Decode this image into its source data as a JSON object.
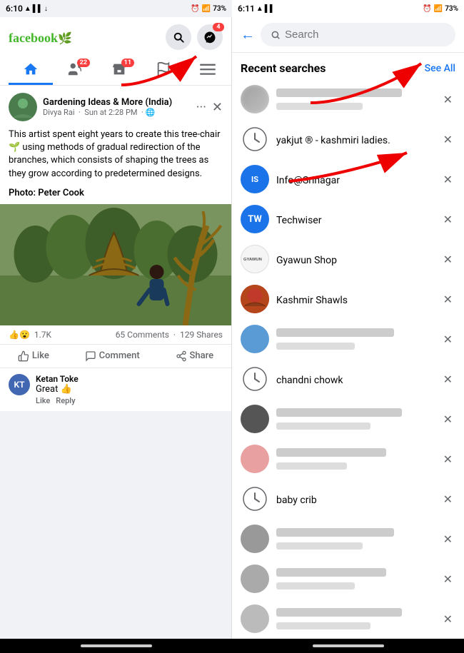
{
  "left_status": {
    "time": "6:10",
    "signal_icon": "signal",
    "battery": "73%"
  },
  "right_status": {
    "time": "6:11",
    "battery": "73%"
  },
  "facebook": {
    "logo": "facebook",
    "logo_leaf": "🌿",
    "nav": {
      "home_label": "Home",
      "friends_badge": "22",
      "marketplace_badge": "11"
    },
    "post": {
      "page_name": "Gardening Ideas & More (India)",
      "author": "Divya Rai",
      "date": "Sun at 2:28 PM",
      "text": "This artist spent eight years to create this tree-chair 🌱 using methods of gradual redirection of the branches, which consists of shaping the trees as they grow according to predetermined designs.",
      "photo_credit": "Photo: Peter Cook",
      "reactions": "1.7K",
      "comments": "65 Comments",
      "shares": "129 Shares",
      "like_label": "Like",
      "comment_label": "Comment",
      "share_label": "Share",
      "commenter_name": "Ketan Toke",
      "commenter_initials": "KT",
      "comment_text": "Great 👍",
      "like_action": "Like",
      "reply_action": "Reply"
    }
  },
  "search_panel": {
    "back_icon": "←",
    "search_placeholder": "Search",
    "recent_title": "Recent searches",
    "see_all": "See All",
    "items": [
      {
        "type": "profile",
        "blurred": true,
        "name": "",
        "sub": ""
      },
      {
        "type": "clock",
        "name": "yakjut ® - kashmiri ladies.",
        "sub": ""
      },
      {
        "type": "profile",
        "avatar_type": "letter",
        "initials": "IS",
        "color": "#1a73e8",
        "name": "Info@Srinagar",
        "sub": ""
      },
      {
        "type": "profile",
        "avatar_type": "tw",
        "name": "Techwiser",
        "sub": ""
      },
      {
        "type": "profile",
        "avatar_type": "gy",
        "name": "Gyawun Shop",
        "sub": ""
      },
      {
        "type": "profile",
        "avatar_type": "ks",
        "name": "Kashmir Shawls",
        "sub": ""
      },
      {
        "type": "profile",
        "blurred": true,
        "avatar_color": "blue",
        "name": "",
        "sub": ""
      },
      {
        "type": "clock",
        "name": "chandni chowk",
        "sub": ""
      },
      {
        "type": "profile",
        "blurred": true,
        "avatar_color": "dark_gray",
        "name": "",
        "sub": ""
      },
      {
        "type": "profile",
        "blurred": true,
        "avatar_color": "pink",
        "name": "",
        "sub": ""
      },
      {
        "type": "clock",
        "name": "baby crib",
        "sub": ""
      },
      {
        "type": "profile",
        "blurred": true,
        "avatar_color": "gray",
        "name": "",
        "sub": ""
      },
      {
        "type": "profile",
        "blurred": true,
        "avatar_color": "gray2",
        "name": "",
        "sub": ""
      },
      {
        "type": "profile",
        "blurred": true,
        "avatar_color": "gray3",
        "name": "",
        "sub": ""
      }
    ]
  }
}
